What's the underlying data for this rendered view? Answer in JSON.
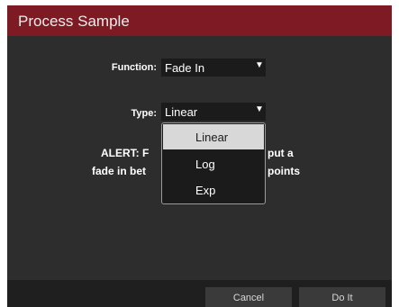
{
  "dialog": {
    "title": "Process Sample"
  },
  "function_field": {
    "label": "Function:",
    "value": "Fade In"
  },
  "type_field": {
    "label": "Type:",
    "value": "Linear"
  },
  "alert": {
    "line1_left": "ALERT: F",
    "line1_right": "put a",
    "line2_left": "fade in bet",
    "line2_right": "points"
  },
  "dropdown": {
    "options": [
      "Linear",
      "Log",
      "Exp"
    ],
    "selected": "Linear"
  },
  "footer": {
    "cancel_label": "Cancel",
    "doit_label": "Do It"
  },
  "icons": {
    "dropdown_arrow": "triangle-down-icon"
  },
  "colors": {
    "titlebar": "#7d1a23",
    "panel": "#2d2d2d",
    "field": "#1b1b1b",
    "selected_option": "#d8d8d8"
  }
}
